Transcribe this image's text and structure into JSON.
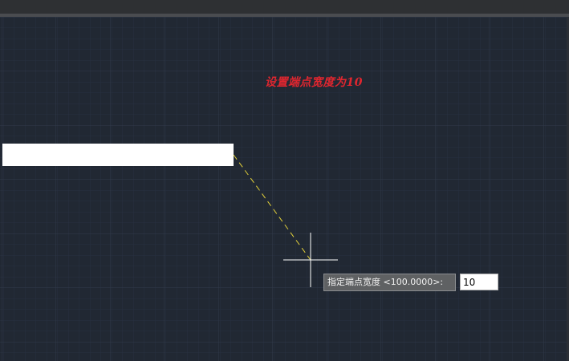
{
  "annotation": {
    "text": "设置端点宽度为10",
    "color": "#e0262f"
  },
  "command_prompt": {
    "label": "指定端点宽度 <100.0000>:",
    "input_value": "10"
  },
  "drawing": {
    "polyline_color": "#ffffff",
    "rubberband_color": "#e3d13a",
    "crosshair_color": "#ffffff",
    "background": "#212833",
    "grid": true
  }
}
